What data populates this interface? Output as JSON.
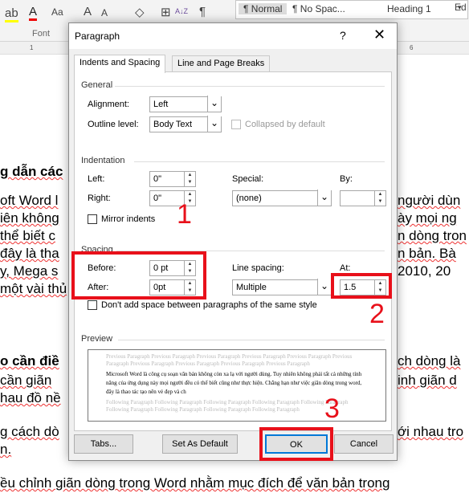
{
  "ribbon": {
    "font_group": "Font",
    "styles": [
      "¶ Normal",
      "¶ No Spac...",
      "Heading 1"
    ],
    "edit_fragment": "Ed",
    "case_label": "Aa",
    "pilcrow": "¶",
    "sort": "A↓Z"
  },
  "ruler": {
    "marks": [
      "1",
      "6"
    ]
  },
  "document": {
    "lines": [
      {
        "text": "g dẫn các",
        "bold": true
      },
      {
        "text": "oft Word l"
      },
      {
        "text": "iên không"
      },
      {
        "text": " thể biết c"
      },
      {
        "text": "đây là tha"
      },
      {
        "text": "y, Mega s"
      },
      {
        "text": "một vài thủ"
      },
      {
        "text": "o cần điề",
        "bold": true
      },
      {
        "text": " cần giãn"
      },
      {
        "text": "hau đồ nề"
      },
      {
        "text": "g cách dò"
      },
      {
        "text": "n."
      },
      {
        "text": "ều chỉnh giãn dòng trong Word nhằm mục đích để văn bản trong"
      }
    ],
    "right_lines": [
      "người dùn",
      "ày mọi ng",
      "n dòng tron",
      "n bản. Bà",
      " 2010, 20",
      "ch dòng là",
      "inh giãn d",
      "ới nhau tro"
    ]
  },
  "dialog": {
    "title": "Paragraph",
    "help": "?",
    "close_icon": "close-icon",
    "tabs": [
      {
        "label": "Indents and Spacing",
        "active": true
      },
      {
        "label": "Line and Page Breaks",
        "active": false
      }
    ],
    "general": {
      "heading": "General",
      "alignment_label": "Alignment:",
      "alignment": "Left",
      "outline_label": "Outline level:",
      "outline": "Body Text",
      "collapsed_label": "Collapsed by default",
      "collapsed": false
    },
    "indentation": {
      "heading": "Indentation",
      "left_label": "Left:",
      "left": "0\"",
      "right_label": "Right:",
      "right": "0\"",
      "special_label": "Special:",
      "special": "(none)",
      "by_label": "By:",
      "by": "",
      "mirror_label": "Mirror indents",
      "mirror": false
    },
    "spacing": {
      "heading": "Spacing",
      "before_label": "Before:",
      "before": "0 pt",
      "after_label": "After:",
      "after": "0pt",
      "line_label": "Line spacing:",
      "line": "Multiple",
      "at_label": "At:",
      "at": "1.5",
      "dont_add_label": "Don't add space between paragraphs of the same style",
      "dont_add": false
    },
    "preview": {
      "heading": "Preview",
      "previous": "Previous Paragraph Previous Paragraph Previous Paragraph Previous Paragraph Previous Paragraph Previous Paragraph Previous Paragraph Previous Paragraph Previous Paragraph Previous Paragraph",
      "sample": "Microsoft Word là công cụ soạn văn bản không còn xa lạ với người dùng. Tuy nhiên không phải tất cả những tính năng của ứng dụng này mọi người đều có thể biết cũng như thực hiện. Chẳng hạn như việc giãn dòng trong word, đây là thao tác tạo nên vẻ đẹp và ch",
      "following": "Following Paragraph Following Paragraph Following Paragraph Following Paragraph Following Paragraph Following Paragraph Following Paragraph Following Paragraph Following Paragraph"
    },
    "buttons": {
      "tabs": "Tabs...",
      "default": "Set As Default",
      "ok": "OK",
      "cancel": "Cancel"
    }
  },
  "annotations": {
    "one": "1",
    "two": "2",
    "three": "3",
    "color": "#e8101a"
  }
}
